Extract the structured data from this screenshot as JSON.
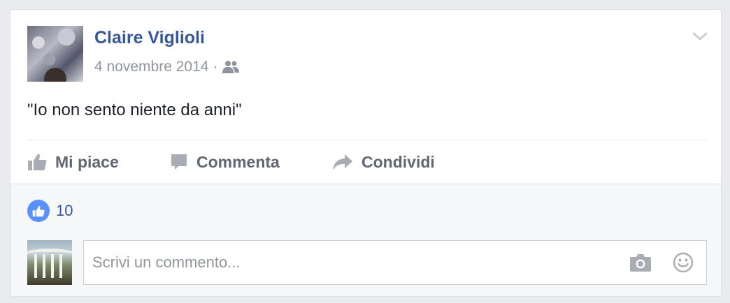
{
  "post": {
    "author": "Claire Viglioli",
    "date": "4 novembre 2014",
    "separator": "·",
    "audience_icon": "friends-icon",
    "text": "\"Io non sento niente da anni\""
  },
  "actions": {
    "like_label": "Mi piace",
    "comment_label": "Commenta",
    "share_label": "Condividi"
  },
  "reactions": {
    "like_count": "10"
  },
  "comment": {
    "placeholder": "Scrivi un commento...",
    "icons": [
      "camera-icon",
      "emoji-icon"
    ]
  },
  "colors": {
    "link": "#365899",
    "muted": "#90949c",
    "like_badge": "#5890ff",
    "action_text": "#616770"
  }
}
